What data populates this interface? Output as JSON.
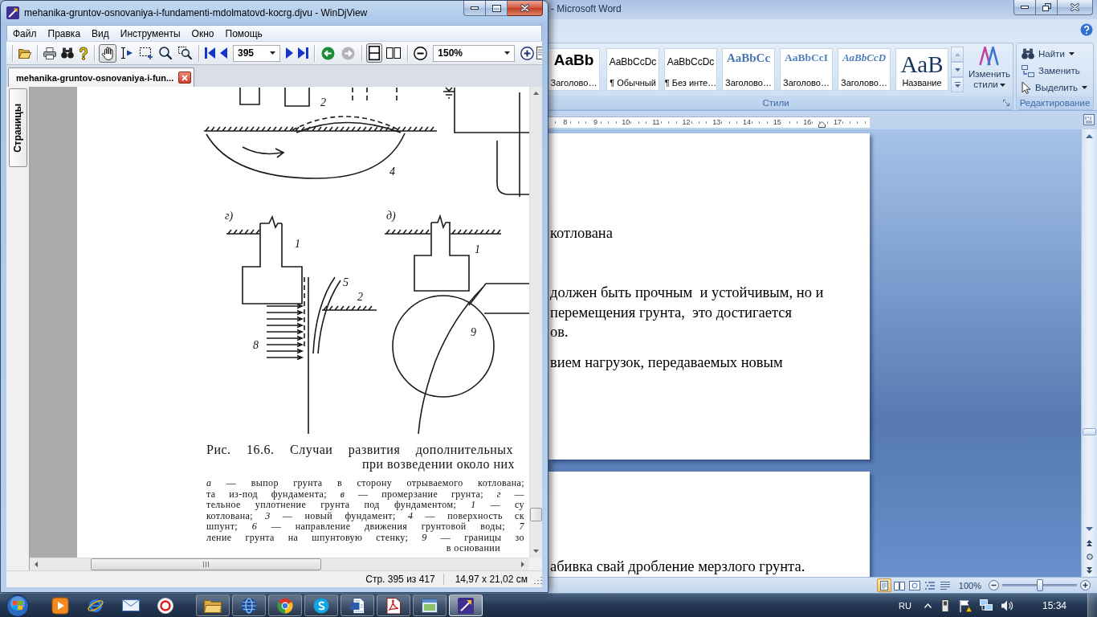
{
  "djview": {
    "title": "mehanika-gruntov-osnovaniya-i-fundamenti-mdolmatovd-kocrg.djvu - WinDjView",
    "menu": [
      "Файл",
      "Правка",
      "Вид",
      "Инструменты",
      "Окно",
      "Помощь"
    ],
    "tools": [
      {
        "selected": true
      },
      {
        "selected": false
      },
      {
        "selected": false
      },
      {
        "selected": false
      },
      {
        "selected": false
      }
    ],
    "page_field": {
      "value": "395"
    },
    "history": [
      {
        "disabled": false
      },
      {
        "disabled": true
      }
    ],
    "layouts": [
      {
        "selected": true
      },
      {
        "selected": false
      }
    ],
    "zoom_field": {
      "value": "150%"
    },
    "tab": {
      "label": "mehanika-gruntov-osnovaniya-i-fun..."
    },
    "sidebar_tab": {
      "label": "Страницы"
    },
    "page": {
      "figure_labels": [
        "2",
        "4",
        "г)",
        "1",
        "5",
        "2",
        "8",
        "д)",
        "1",
        "9"
      ],
      "caption": [
        "Рис. 16.6. Случаи развития дополнительных",
        "при возведении около них"
      ],
      "legend": [
        "*а* — выпор грунта в сторону отрываемого котлована;",
        "та из-под фундамента; *в* — промерзание грунта; *г* —",
        "тельное уплотнение грунта под фундаментом; *1* — су",
        "котлована; *3* — новый фундамент; *4* — поверхность ск",
        "шпунт; *6* — направление движения грунтовой воды; *7*",
        "ление грунта на шпунтовую стенку; *9* — границы зо",
        "в основании"
      ]
    },
    "status_bar": [
      "Стр. 395 из 417",
      "14,97 x 21,02 см"
    ]
  },
  "word": {
    "title": "- Microsoft Word",
    "styles": [
      {
        "kind": "strong",
        "preview": "AaBb",
        "label": "Заголово…"
      },
      {
        "kind": "body",
        "preview": "AaBbCcDc",
        "label": "¶ Обычный"
      },
      {
        "kind": "body",
        "preview": "AaBbCcDc",
        "label": "¶ Без инте…"
      },
      {
        "kind": "heading",
        "preview": "AaBbCc",
        "label": "Заголово…"
      },
      {
        "kind": "subheading",
        "preview": "AaBbCcI",
        "label": "Заголово…"
      },
      {
        "kind": "emphasis",
        "preview": "AaBbCcD",
        "label": "Заголово…"
      },
      {
        "kind": "title",
        "preview": "AaB",
        "label": "Название"
      }
    ],
    "change_styles": "Изменить стили",
    "styles_group": "Стили",
    "editing": [
      {
        "label": "Найти",
        "has_menu": true
      },
      {
        "label": "Заменить",
        "has_menu": false
      },
      {
        "label": "Выделить",
        "has_menu": true
      }
    ],
    "editing_group": "Редактирование",
    "ruler": [
      "8",
      "9",
      "10",
      "11",
      "12",
      "13",
      "14",
      "15",
      "16",
      "17"
    ],
    "pages": [
      {
        "paragraphs": [
          {
            "lines": [
              "котлована"
            ]
          },
          {
            "lines": [
              "должен быть прочным  и устойчивым, но и",
              "перемещения грунта,  это достигается",
              "ов."
            ]
          },
          {
            "lines": [
              "вием нагрузок, передаваемых новым"
            ]
          }
        ]
      },
      {
        "paragraphs": [
          {
            "lines": [
              "абивка свай дробление мерзлого грунта."
            ]
          }
        ]
      }
    ],
    "views": [
      {
        "selected": true
      },
      {
        "selected": false
      },
      {
        "selected": false
      },
      {
        "selected": false
      },
      {
        "selected": false
      }
    ],
    "zoom": "100%",
    "zoom_slider": {
      "level": 0.5
    }
  },
  "taskbar": {
    "tasks": [
      {
        "selected": false
      },
      {
        "selected": false
      },
      {
        "selected": false
      },
      {
        "selected": false
      },
      {
        "selected": false
      },
      {
        "selected": false
      },
      {
        "selected": false
      },
      {
        "selected": true
      }
    ],
    "tray": {
      "language": "RU",
      "time": "15:34"
    }
  }
}
